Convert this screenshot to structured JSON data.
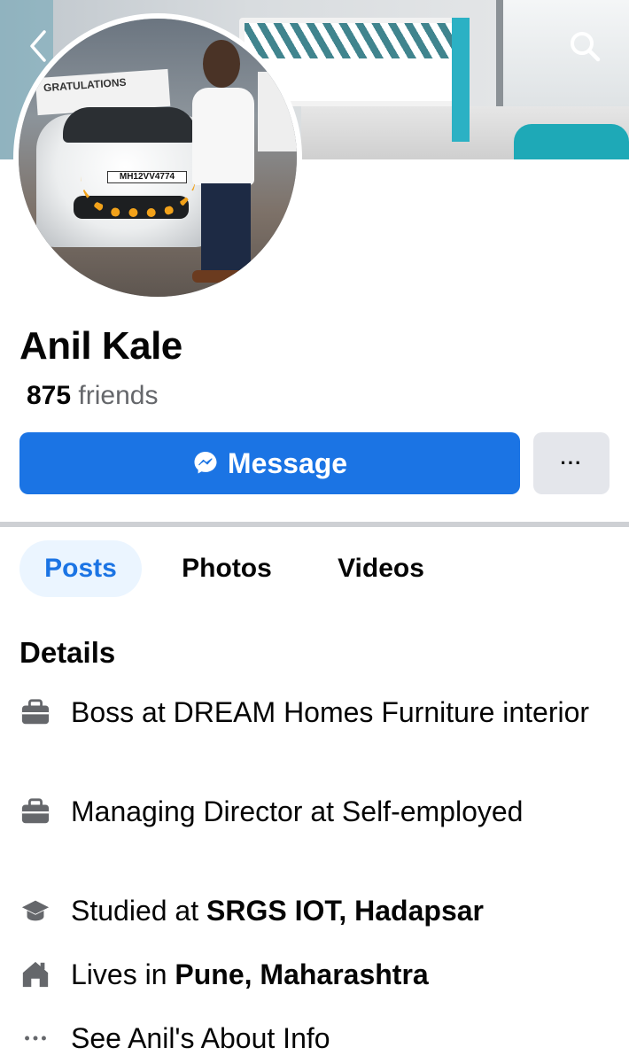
{
  "profile": {
    "name": "Anil Kale",
    "friends_count": "875",
    "friends_label": " friends",
    "plate_text": "MH12VV4774",
    "banner_text": "GRATULATIONS"
  },
  "actions": {
    "message_label": "Message",
    "more_label": "···"
  },
  "tabs": [
    {
      "label": "Posts"
    },
    {
      "label": "Photos"
    },
    {
      "label": "Videos"
    }
  ],
  "details": {
    "title": "Details",
    "items": [
      {
        "icon": "briefcase-icon",
        "text": "Boss at DREAM Homes Furniture interior"
      },
      {
        "icon": "briefcase-icon",
        "text": "Managing Director at Self-employed"
      },
      {
        "icon": "graduation-cap-icon",
        "prefix": "Studied at ",
        "bold": "SRGS IOT, Hadapsar"
      },
      {
        "icon": "home-icon",
        "prefix": "Lives in ",
        "bold": "Pune, Maharashtra"
      },
      {
        "icon": "more-dots-icon",
        "text": "See Anil's About Info"
      }
    ]
  },
  "colors": {
    "accent": "#1b74e4",
    "secondary_button": "#e4e6eb",
    "muted_text": "#65676b"
  }
}
